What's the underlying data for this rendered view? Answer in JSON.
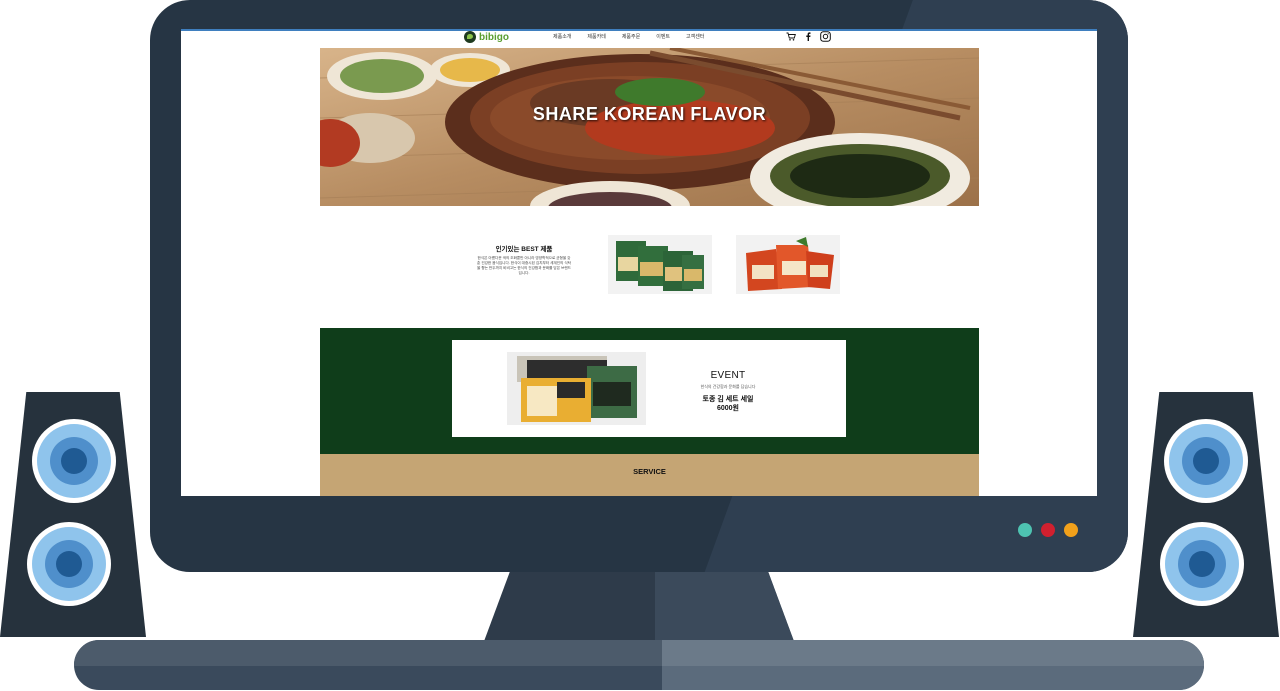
{
  "site": {
    "logo": "bibigo",
    "menu": [
      "제품소개",
      "제품카테",
      "제품주문",
      "이벤트",
      "고객센터"
    ],
    "icons": [
      "cart-icon",
      "facebook-icon",
      "instagram-icon"
    ]
  },
  "hero": {
    "title": "SHARE KOREAN FLAVOR"
  },
  "best": {
    "heading": "인기있는 BEST 제품",
    "body": "한식은 아름다운 색의 조화뿐만 아니라 영양학적으로 균형을 갖춘 건강한 음식입니다. 한식이 대중시된 김치부터 세계인의 식탁을 향는 만두까지 비비고는 한식의 건강함과 문화를 담은 브랜드입니다."
  },
  "event": {
    "title": "EVENT",
    "subtitle": "한식의 건강함과 문화를 담습니다",
    "deal_line1": "토종 김 세트 세일",
    "deal_line2": "6000원"
  },
  "service": {
    "title": "SERVICE"
  },
  "colors": {
    "event_band": "#0f3d1a",
    "service_band": "#c5a574",
    "monitor": "#263544",
    "led_teal": "#4ec3b1",
    "led_red": "#d1202f",
    "led_orange": "#f2a11b"
  }
}
